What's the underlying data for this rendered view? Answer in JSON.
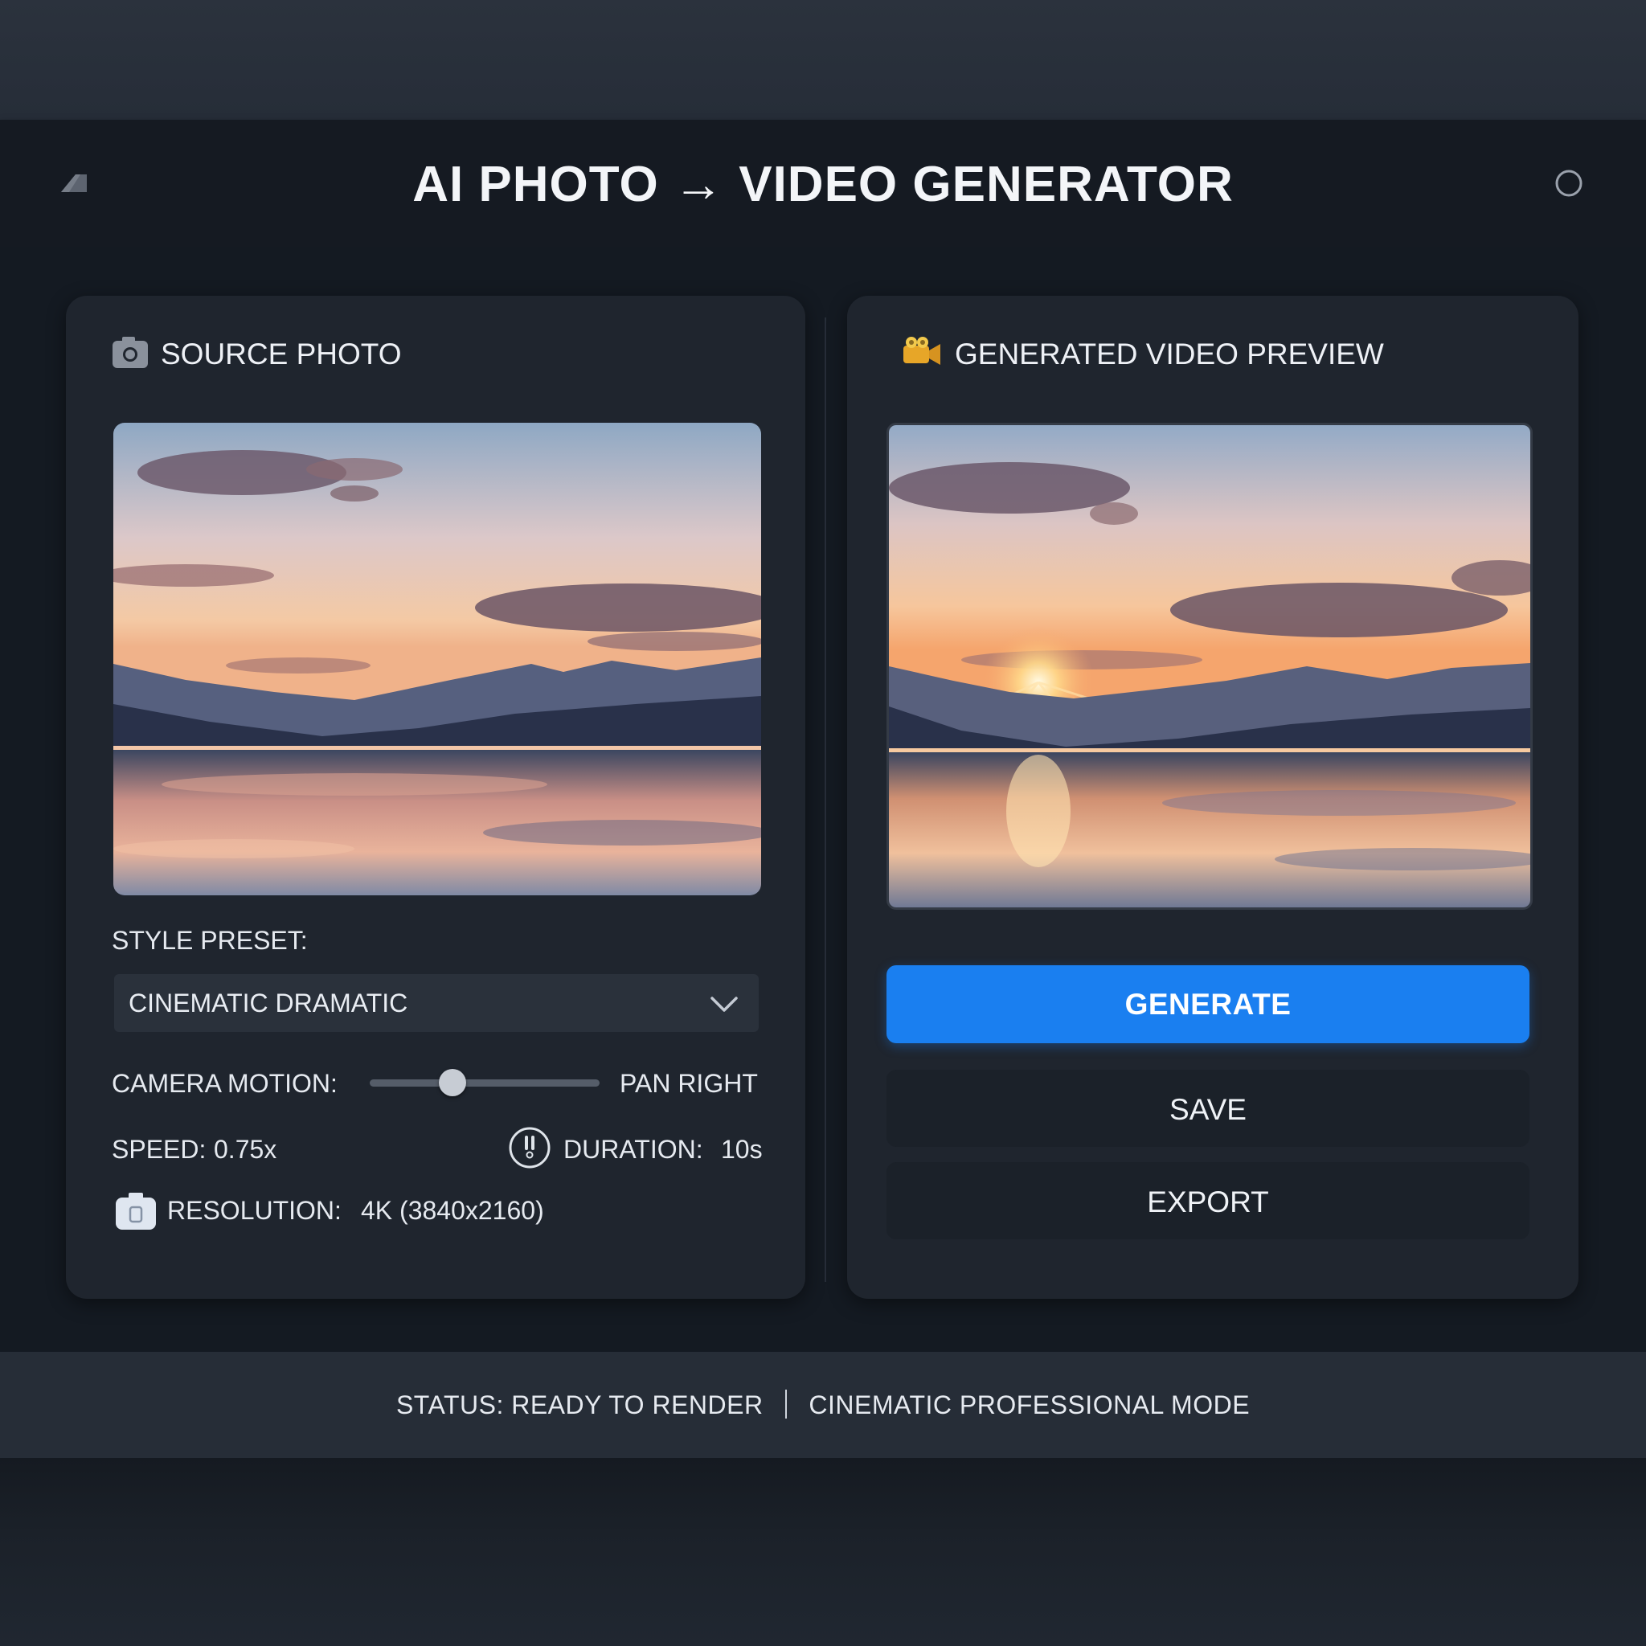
{
  "app": {
    "title": "AI PHOTO → VIDEO GENERATOR",
    "left_icon": "diamond-logo-icon",
    "right_icon": "circle-icon"
  },
  "source_panel": {
    "heading": "SOURCE PHOTO",
    "heading_icon": "camera-icon",
    "photo_subject": "sunset-mountain-lake",
    "style_preset": {
      "label": "STYLE PRESET:",
      "selected": "CINEMATIC DRAMATIC",
      "icon": "chevron-down-icon"
    },
    "camera_motion": {
      "label": "CAMERA MOTION:",
      "value": "PAN RIGHT",
      "slider_fraction": 0.36
    },
    "speed": {
      "label": "SPEED:",
      "value": "0.75x"
    },
    "duration": {
      "label": "DURATION:",
      "value": "10s",
      "icon": "timer-icon"
    },
    "resolution": {
      "label": "RESOLUTION:",
      "value": "4K (3840x2160)",
      "icon": "camera-small-icon"
    }
  },
  "preview_panel": {
    "heading": "GENERATED VIDEO PREVIEW",
    "heading_icon": "video-camera-icon",
    "photo_subject": "sunset-mountain-lake-sunburst",
    "generate_label": "GENERATE",
    "save_label": "SAVE",
    "export_label": "EXPORT"
  },
  "status_bar": {
    "status_label": "STATUS:",
    "status_value": "READY TO RENDER",
    "mode": "CINEMATIC PROFESSIONAL MODE"
  },
  "colors": {
    "accent": "#1a7ff0",
    "panel": "#1f252e",
    "background": "#141a22"
  }
}
